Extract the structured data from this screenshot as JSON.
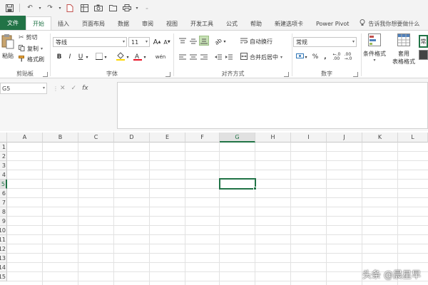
{
  "colors": {
    "accent": "#217346",
    "font_color_swatch": "#e81123",
    "fill_color_swatch": "#ffd700"
  },
  "quick_access": {
    "icons": [
      "save-icon",
      "undo-icon",
      "redo-icon",
      "new-icon",
      "table-icon",
      "printer-icon",
      "open-icon",
      "camera-icon",
      "customize-icon"
    ]
  },
  "tabs": {
    "file": "文件",
    "items": [
      "开始",
      "插入",
      "页面布局",
      "数据",
      "审阅",
      "视图",
      "开发工具",
      "公式",
      "帮助",
      "新建选项卡",
      "Power Pivot"
    ],
    "active_index": 0,
    "tell_me": "告诉我你想要做什么"
  },
  "ribbon": {
    "clipboard": {
      "paste": "粘贴",
      "cut": "剪切",
      "copy": "复制",
      "format_painter": "格式刷",
      "label": "剪贴板"
    },
    "font": {
      "font_name": "等线",
      "font_size": "11",
      "grow": "A",
      "shrink": "A",
      "bold": "B",
      "italic": "I",
      "underline": "U",
      "phonetic": "wén",
      "label": "字体"
    },
    "alignment": {
      "wrap_text": "自动换行",
      "merge_center": "合并后居中",
      "label": "对齐方式"
    },
    "number": {
      "format": "常规",
      "percent": "%",
      "comma": ",",
      "label": "数字"
    },
    "styles": {
      "conditional_format": "条件格式",
      "table_format_1": "套用",
      "table_format_2": "表格格式",
      "style_preview": "常"
    }
  },
  "formula_bar": {
    "name_box": "G5",
    "cancel": "✕",
    "enter": "✓",
    "fx": "fx",
    "formula": ""
  },
  "grid": {
    "columns": [
      "A",
      "B",
      "C",
      "D",
      "E",
      "F",
      "G",
      "H",
      "I",
      "J",
      "K",
      "L"
    ],
    "rows": [
      "1",
      "2",
      "3",
      "4",
      "5",
      "6",
      "7",
      "8",
      "9",
      "10",
      "11",
      "12",
      "13",
      "14",
      "15"
    ],
    "selected_column": "G",
    "selected_row": "5"
  },
  "watermark": "头条 @晨星早"
}
